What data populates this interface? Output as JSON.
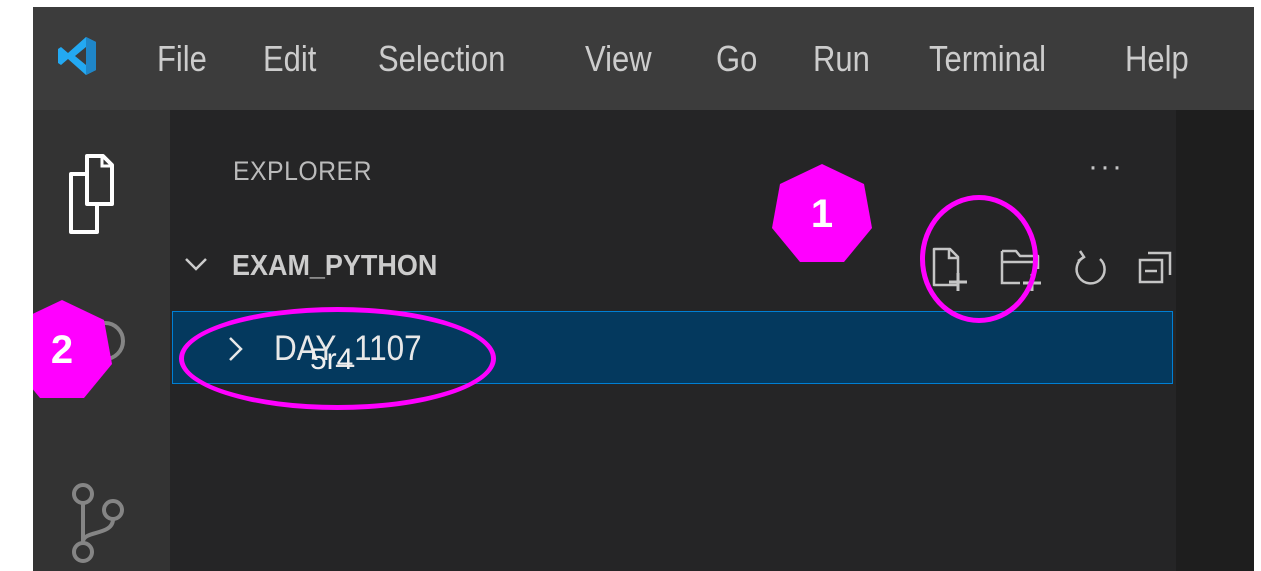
{
  "menu": {
    "items": [
      {
        "label": "File"
      },
      {
        "label": "Edit"
      },
      {
        "label": "Selection"
      },
      {
        "label": "View"
      },
      {
        "label": "Go"
      },
      {
        "label": "Run"
      },
      {
        "label": "Terminal"
      },
      {
        "label": "Help"
      }
    ]
  },
  "activity_bar": {
    "icons": [
      "explorer-icon",
      "search-icon",
      "source-control-icon"
    ]
  },
  "explorer": {
    "title": "EXPLORER",
    "more_actions": "···",
    "workspace": {
      "name": "EXAM_PYTHON",
      "actions": [
        "new-file-icon",
        "new-folder-icon",
        "refresh-icon",
        "collapse-all-icon"
      ]
    },
    "tree": [
      {
        "label": "DAY_1107",
        "overlay_text": "5r4",
        "selected": true,
        "expanded": false
      }
    ]
  },
  "annotations": {
    "badge_1": "1",
    "badge_2": "2",
    "color": "#ff00ff"
  },
  "colors": {
    "titlebar": "#3c3c3c",
    "activity_bar": "#333333",
    "sidebar": "#252526",
    "selection": "#04395e",
    "focus_border": "#007fd4",
    "logo": "#23a9f2"
  }
}
